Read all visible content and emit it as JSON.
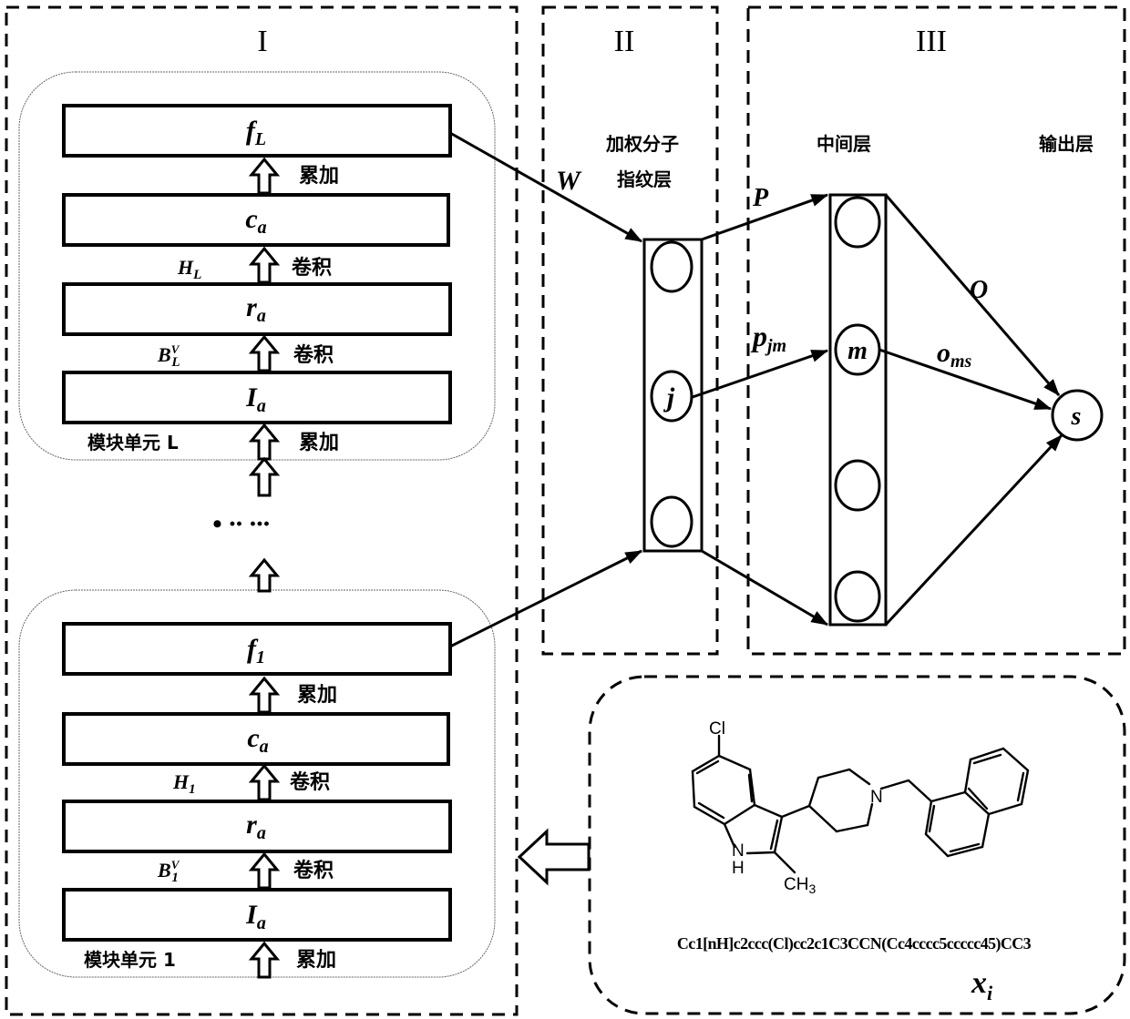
{
  "sections": {
    "I": {
      "label": "I"
    },
    "II": {
      "label": "II",
      "layer_title_line1": "加权分子",
      "layer_title_line2": "指纹层"
    },
    "III": {
      "label": "III",
      "hidden_title": "中间层",
      "output_title": "输出层"
    }
  },
  "modules": [
    {
      "id": "module-L",
      "unit_label": "模块单元 L",
      "layers": [
        {
          "base": "f",
          "sub": "L"
        },
        {
          "base": "c",
          "sub": "a"
        },
        {
          "base": "r",
          "sub": "a"
        },
        {
          "base": "I",
          "sub": "a"
        }
      ],
      "transitions": [
        {
          "op": "累加",
          "param_base": "",
          "param_sub": "",
          "param_sup": ""
        },
        {
          "op": "卷积",
          "param_base": "H",
          "param_sub": "L",
          "param_sup": ""
        },
        {
          "op": "卷积",
          "param_base": "B",
          "param_sub": "L",
          "param_sup": "V"
        },
        {
          "op": "累加",
          "param_base": "",
          "param_sub": "",
          "param_sup": ""
        }
      ]
    },
    {
      "id": "module-1",
      "unit_label": "模块单元 1",
      "layers": [
        {
          "base": "f",
          "sub": "1"
        },
        {
          "base": "c",
          "sub": "a"
        },
        {
          "base": "r",
          "sub": "a"
        },
        {
          "base": "I",
          "sub": "a"
        }
      ],
      "transitions": [
        {
          "op": "累加",
          "param_base": "",
          "param_sub": "",
          "param_sup": ""
        },
        {
          "op": "卷积",
          "param_base": "H",
          "param_sub": "1",
          "param_sup": ""
        },
        {
          "op": "卷积",
          "param_base": "B",
          "param_sub": "1",
          "param_sup": "V"
        },
        {
          "op": "累加",
          "param_base": "",
          "param_sub": "",
          "param_sup": ""
        }
      ]
    }
  ],
  "ellipsis": "• ·· ···",
  "edges": {
    "W": "W",
    "P": "P",
    "p_jm_base": "p",
    "p_jm_sub": "jm",
    "O": "O",
    "o_ms_base": "o",
    "o_ms_sub": "ms"
  },
  "nodes": {
    "fingerprint_node": "j",
    "hidden_node": "m",
    "output_node": "s"
  },
  "molecule": {
    "atom_cl": "Cl",
    "atom_n_ring": "N",
    "atom_nh_n": "N",
    "atom_nh_h": "H",
    "atom_ch3": "CH",
    "atom_ch3_sub": "3",
    "smiles": "Cc1[nH]c2ccc(Cl)cc2c1C3CCN(Cc4cccc5ccccc45)CC3",
    "input_label_base": "x",
    "input_label_sub": "i"
  }
}
